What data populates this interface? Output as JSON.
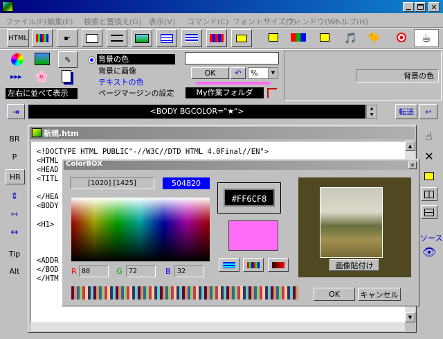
{
  "colors": {
    "title_start": "#000080",
    "title_end": "#1084d0",
    "dark": "#000000",
    "accent_hex": "#FF6CF8",
    "highlight_blue": "#0000ff"
  },
  "menu": [
    "ファイル(F)",
    "編集(E)",
    "検索と置換え(G)",
    "表示(V)",
    "コマンド(C)",
    "フォントサイズ(T)",
    "ウィンドウ(W)",
    "ヘルプ(H)"
  ],
  "toolbar": {
    "html_label": "HTML"
  },
  "options": {
    "bg_color": "背景の色",
    "bg_image": "背景に画像",
    "text_color": "テキストの色",
    "page_margin": "ページマージンの設定",
    "arrange": "左右に並べて表示"
  },
  "controls": {
    "ok": "OK",
    "unit": "%",
    "folder": "My作業フォルダ"
  },
  "right_panel": {
    "label": "背景の色"
  },
  "tagbar": {
    "tag": "<BODY BGCOLOR=\"★\">",
    "send": "転送"
  },
  "left_side": [
    "BR",
    "P",
    "HR",
    "Tip",
    "Alt"
  ],
  "editor": {
    "title": "新規.htm",
    "lines": [
      "<!DOCTYPE HTML PUBLIC\"-//W3C//DTD HTML 4.0Final//EN\">",
      "<HTML",
      "<HEAD",
      "<TITL",
      "</HEA",
      "<BODY",
      "<H1>",
      "<ADDR",
      "</BOD",
      "</HTM"
    ]
  },
  "right_side": {
    "source": "ソース"
  },
  "colorbox": {
    "title": "ColorBOX",
    "coords": "[1020]  [1425]",
    "value": "504820",
    "hex": "#FF6CF8",
    "r_label": "R",
    "g_label": "G",
    "b_label": "B",
    "r": "80",
    "g": "72",
    "b": "32",
    "paste": "画像貼付け",
    "ok": "OK",
    "cancel": "キャンセル"
  }
}
